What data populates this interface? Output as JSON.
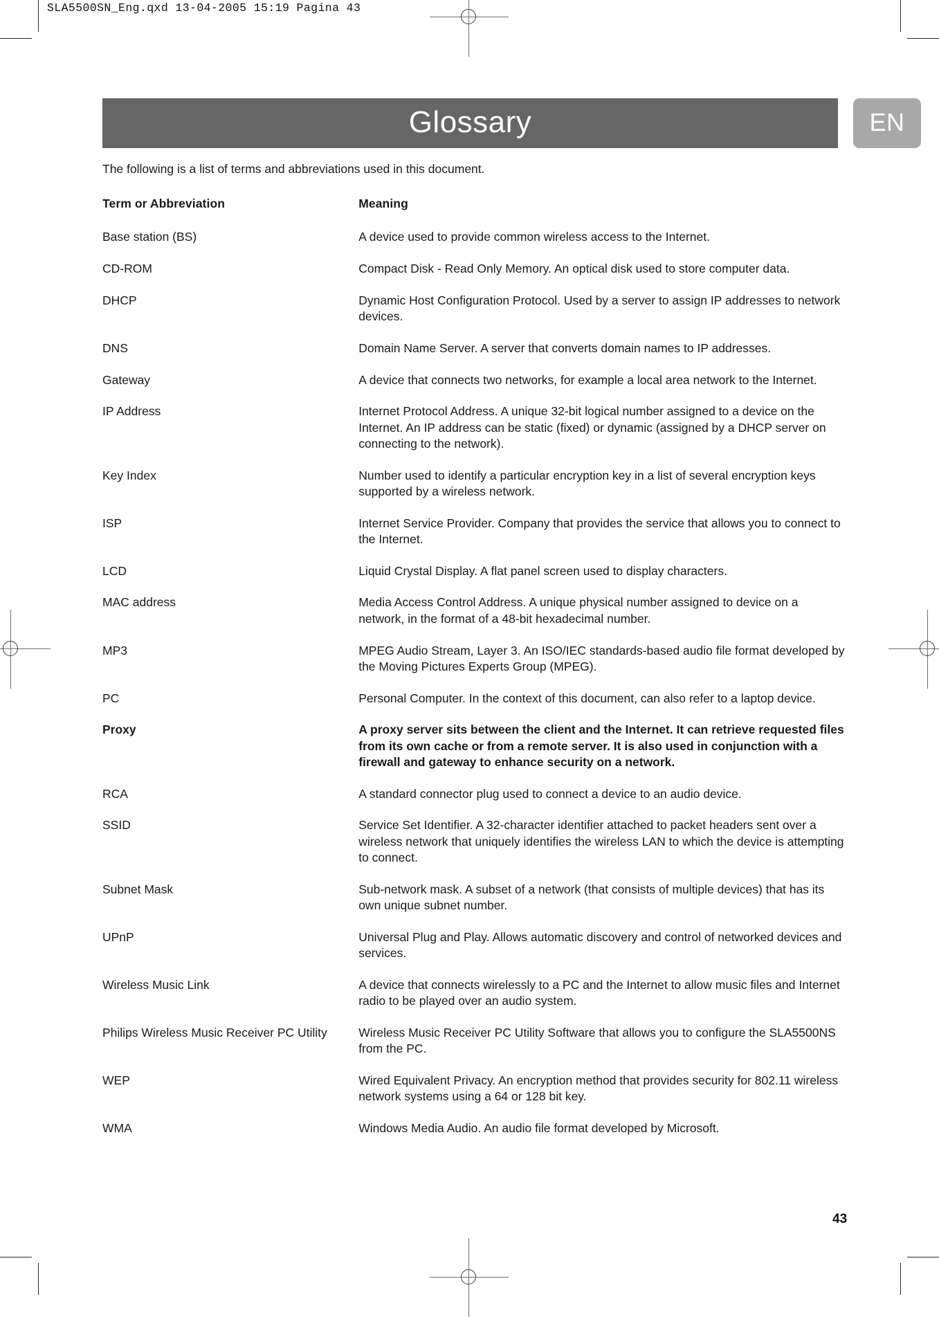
{
  "print_stamp": "SLA5500SN_Eng.qxd  13-04-2005  15:19  Pagina 43",
  "header": {
    "title": "Glossary",
    "language_badge": "EN",
    "titlebar_color": "#666666",
    "badge_color": "#a8a8a8"
  },
  "intro": "The following is a list of terms and abbreviations used in this document.",
  "table": {
    "columns": {
      "term": "Term or Abbreviation",
      "meaning": "Meaning"
    },
    "rows": [
      {
        "term": "Base station (BS)",
        "meaning": "A device used to provide common wireless access to the Internet.",
        "emphasis": false
      },
      {
        "term": "CD-ROM",
        "meaning": "Compact Disk - Read Only Memory. An optical disk used to store computer data.",
        "emphasis": false
      },
      {
        "term": "DHCP",
        "meaning": "Dynamic Host Configuration Protocol. Used by a server to assign IP  addresses to network devices.",
        "emphasis": false
      },
      {
        "term": "DNS",
        "meaning": "Domain Name Server. A server that converts domain names to IP addresses.",
        "emphasis": false
      },
      {
        "term": "Gateway",
        "meaning": "A device that connects two networks, for example a local area network  to the Internet.",
        "emphasis": false
      },
      {
        "term": "IP Address",
        "meaning": "Internet Protocol Address. A unique 32-bit logical number assigned to a device on the Internet. An IP address can be static (fixed) or dynamic (assigned by a DHCP server on connecting to the network).",
        "emphasis": false
      },
      {
        "term": "Key Index",
        "meaning": "Number used to identify a particular encryption key in a list of several encryption keys supported by a wireless network.",
        "emphasis": false
      },
      {
        "term": "ISP",
        "meaning": "Internet Service Provider. Company that provides the service that allows you to connect to the Internet.",
        "emphasis": false
      },
      {
        "term": "LCD",
        "meaning": "Liquid Crystal Display. A flat panel screen used to display characters.",
        "emphasis": false
      },
      {
        "term": "MAC address",
        "meaning": "Media Access Control Address. A unique physical number assigned to device on a network, in the format of a 48-bit hexadecimal number.",
        "emphasis": false
      },
      {
        "term": "MP3",
        "meaning": "MPEG Audio Stream, Layer 3. An ISO/IEC standards-based audio file format developed by the Moving Pictures Experts Group (MPEG).",
        "emphasis": false
      },
      {
        "term": "PC",
        "meaning": "Personal Computer. In the context of this document, can also refer to a laptop device.",
        "emphasis": false
      },
      {
        "term": "Proxy",
        "meaning": "A proxy server sits between the client and the Internet. It can retrieve requested files from its own cache or from a remote server. It is also used in conjunction with a firewall and gateway to enhance security on a network.",
        "emphasis": true
      },
      {
        "term": "RCA",
        "meaning": "A standard connector plug used to connect a device to an audio device.",
        "emphasis": false
      },
      {
        "term": "SSID",
        "meaning": "Service Set Identifier. A 32-character identifier attached to packet headers sent over a wireless network that uniquely identifies the wireless LAN to which the device is attempting to connect.",
        "emphasis": false
      },
      {
        "term": "Subnet Mask",
        "meaning": "Sub-network mask. A subset of a network (that consists of multiple devices) that has its own unique subnet number.",
        "emphasis": false
      },
      {
        "term": "UPnP",
        "meaning": "Universal Plug and Play. Allows automatic discovery and control of networked devices and services.",
        "emphasis": false
      },
      {
        "term": "Wireless Music Link",
        "meaning": "A device that connects wirelessly to a PC and the Internet to allow music files and Internet radio to be played over an audio system.",
        "emphasis": false
      },
      {
        "term": "Philips Wireless Music Receiver PC Utility",
        "meaning": "Wireless Music Receiver PC Utility Software that allows you to configure the SLA5500NS from the PC.",
        "emphasis": false
      },
      {
        "term": "WEP",
        "meaning": "Wired Equivalent Privacy. An encryption method that provides security for 802.11 wireless network systems using a 64 or 128 bit key.",
        "emphasis": false
      },
      {
        "term": "WMA",
        "meaning": "Windows Media Audio. An audio file format developed by Microsoft.",
        "emphasis": false
      }
    ]
  },
  "page_number": "43"
}
